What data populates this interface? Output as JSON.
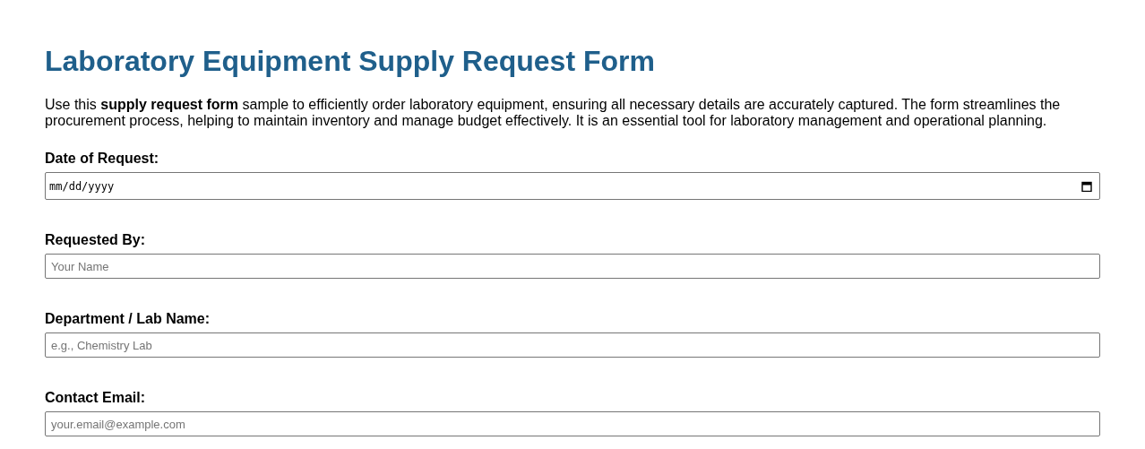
{
  "title": "Laboratory Equipment Supply Request Form",
  "intro": "Use this **supply request form** sample to efficiently order laboratory equipment, ensuring all necessary details are accurately captured. The form streamlines the procurement process, helping to maintain inventory and manage budget effectively. It is an essential tool for laboratory management and operational planning.",
  "fields": [
    {
      "label": "Date of Request:",
      "kind": "date",
      "value": "mm/dd/yyyy"
    },
    {
      "label": "Requested By:",
      "kind": "text",
      "placeholder": "Your Name"
    },
    {
      "label": "Department / Lab Name:",
      "kind": "text",
      "placeholder": "e.g., Chemistry Lab"
    },
    {
      "label": "Contact Email:",
      "kind": "text",
      "placeholder": "your.email@example.com"
    }
  ]
}
